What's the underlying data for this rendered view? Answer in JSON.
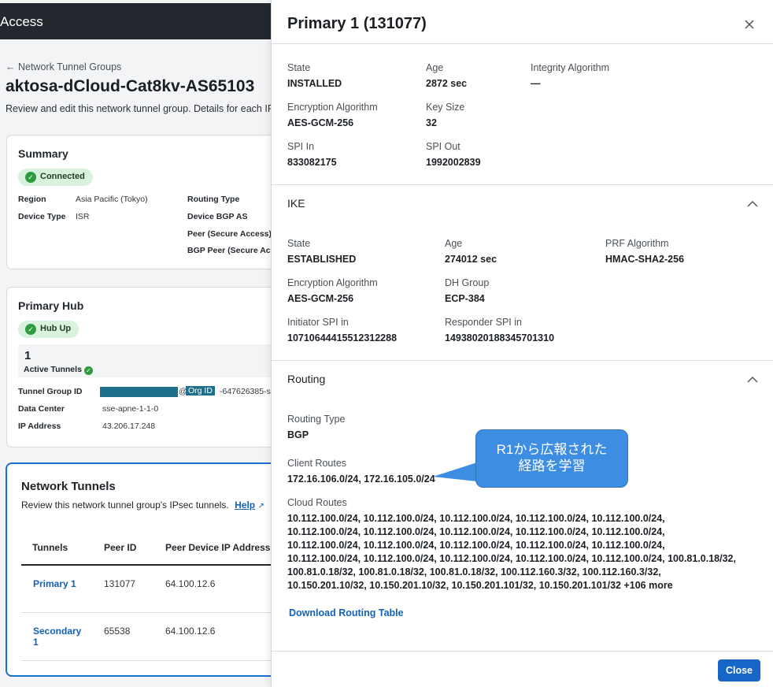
{
  "background": {
    "topbar_title": "Access",
    "back_link": "← Network Tunnel Groups",
    "page_title": "aktosa-dCloud-Cat8kv-AS65103",
    "page_description": "Review and edit this network tunnel group. Details for each IP",
    "summary": {
      "title": "Summary",
      "status": "Connected",
      "region_label": "Region",
      "region_value": "Asia Pacific (Tokyo)",
      "device_type_label": "Device Type",
      "device_type_value": "ISR",
      "routing_type_label": "Routing Type",
      "device_bgp_label": "Device BGP AS",
      "peer_label": "Peer (Secure Access)",
      "bgp_peer_label": "BGP Peer (Secure Acc"
    },
    "primary_hub": {
      "title": "Primary Hub",
      "status": "Hub Up",
      "active_tunnels_count": "1",
      "active_tunnels_label": "Active Tunnels",
      "tunnel_group_id_label": "Tunnel Group ID",
      "org_id_tag": "Org ID",
      "tunnel_group_id_suffix": "-647626385-s",
      "data_center_label": "Data Center",
      "data_center_value": "sse-apne-1-1-0",
      "ip_address_label": "IP Address",
      "ip_address_value": "43.206.17.248"
    },
    "network_tunnels": {
      "title": "Network Tunnels",
      "description": "Review this network tunnel group's IPsec tunnels.",
      "help_link": "Help",
      "columns": [
        "Tunnels",
        "Peer ID",
        "Peer Device IP Address"
      ],
      "rows": [
        {
          "tunnel": "Primary 1",
          "peer_id": "131077",
          "peer_ip": "64.100.12.6"
        },
        {
          "tunnel": "Secondary 1",
          "peer_id": "65538",
          "peer_ip": "64.100.12.6"
        }
      ]
    }
  },
  "drawer": {
    "title": "Primary 1 (131077)",
    "ipsec": {
      "state_label": "State",
      "state_value": "INSTALLED",
      "age_label": "Age",
      "age_value": "2872 sec",
      "integrity_label": "Integrity Algorithm",
      "integrity_value": "—",
      "enc_label": "Encryption Algorithm",
      "enc_value": "AES-GCM-256",
      "keysize_label": "Key Size",
      "keysize_value": "32",
      "spi_in_label": "SPI In",
      "spi_in_value": "833082175",
      "spi_out_label": "SPI Out",
      "spi_out_value": "1992002839"
    },
    "ike": {
      "title": "IKE",
      "state_label": "State",
      "state_value": "ESTABLISHED",
      "age_label": "Age",
      "age_value": "274012 sec",
      "prf_label": "PRF Algorithm",
      "prf_value": "HMAC-SHA2-256",
      "enc_label": "Encryption Algorithm",
      "enc_value": "AES-GCM-256",
      "dh_label": "DH Group",
      "dh_value": "ECP-384",
      "init_spi_label": "Initiator SPI in",
      "init_spi_value": "10710644415512312288",
      "resp_spi_label": "Responder SPI in",
      "resp_spi_value": "14938020188345701310"
    },
    "routing": {
      "title": "Routing",
      "routing_type_label": "Routing Type",
      "routing_type_value": "BGP",
      "client_routes_label": "Client Routes",
      "client_routes_value": "172.16.106.0/24, 172.16.105.0/24",
      "cloud_routes_label": "Cloud Routes",
      "cloud_routes_value": "10.112.100.0/24, 10.112.100.0/24, 10.112.100.0/24, 10.112.100.0/24, 10.112.100.0/24, 10.112.100.0/24, 10.112.100.0/24, 10.112.100.0/24, 10.112.100.0/24, 10.112.100.0/24, 10.112.100.0/24, 10.112.100.0/24, 10.112.100.0/24, 10.112.100.0/24, 10.112.100.0/24, 10.112.100.0/24, 10.112.100.0/24, 10.112.100.0/24, 10.112.100.0/24, 10.112.100.0/24, 100.81.0.18/32, 100.81.0.18/32, 100.81.0.18/32, 100.81.0.18/32, 100.112.160.3/32, 100.112.160.3/32, 10.150.201.10/32, 10.150.201.10/32, 10.150.201.101/32, 10.150.201.101/32 +106 more",
      "download_link": "Download Routing Table"
    },
    "close_button": "Close"
  },
  "callout": {
    "line1": "R1から広報された",
    "line2": "経路を学習"
  },
  "colors": {
    "accent": "#1666c8",
    "link": "#1561b8",
    "success": "#2e9c3e",
    "callout": "#3d8ee2",
    "topbar": "#23282e"
  }
}
